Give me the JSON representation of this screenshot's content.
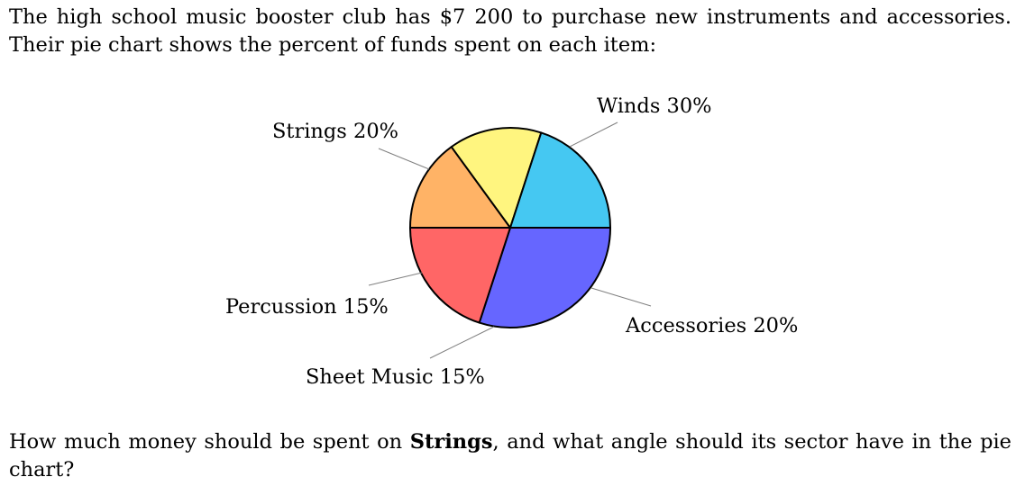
{
  "problem": {
    "intro": "The high school music booster club has $7 200 to purchase new instruments and accessories. Their pie chart shows the percent of funds spent on each item:",
    "question_before": "How much money should be spent on ",
    "question_bold": "Strings",
    "question_after": ", and what angle should its sector have in the pie chart?"
  },
  "chart_data": {
    "type": "pie",
    "title": "",
    "slices": [
      {
        "label": "Winds",
        "value": 30,
        "display": "Winds 30%",
        "color": "#6666ff"
      },
      {
        "label": "Accessories",
        "value": 20,
        "display": "Accessories 20%",
        "color": "#ff6666"
      },
      {
        "label": "Sheet Music",
        "value": 15,
        "display": "Sheet Music 15%",
        "color": "#ffb366"
      },
      {
        "label": "Percussion",
        "value": 15,
        "display": "Percussion 15%",
        "color": "#fff57f"
      },
      {
        "label": "Strings",
        "value": 20,
        "display": "Strings 20%",
        "color": "#45c8f2"
      }
    ],
    "start_angle_deg": 0,
    "direction": "clockwise",
    "outline_color": "#000000",
    "leader_line_color": "#808080"
  }
}
